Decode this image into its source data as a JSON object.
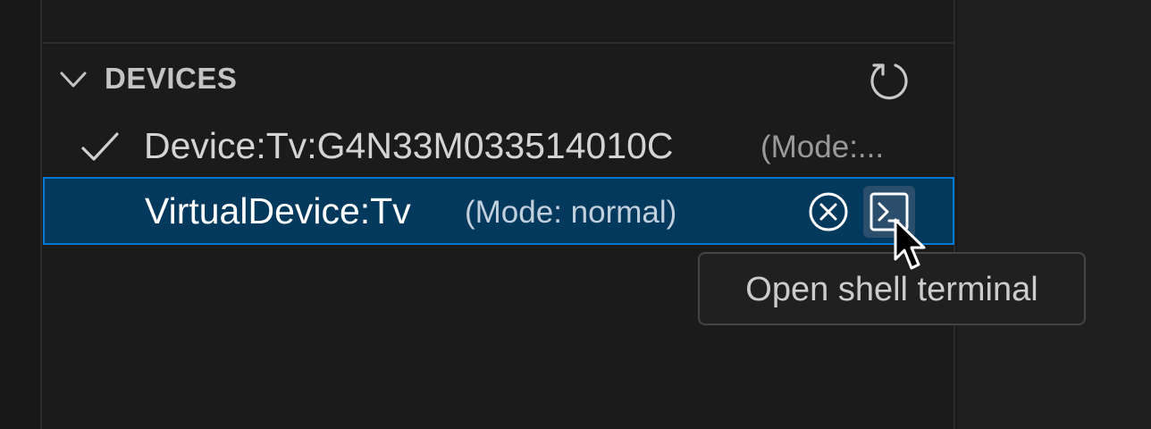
{
  "section": {
    "title": "DEVICES",
    "chevron_icon": "chevron-down-icon",
    "refresh_icon": "refresh-icon"
  },
  "devices": [
    {
      "label": "Device:Tv:G4N33M033514010C",
      "description": "(Mode:...",
      "status_icon": "checkmark-icon",
      "selected": false
    },
    {
      "label": "VirtualDevice:Tv",
      "description": "(Mode: normal)",
      "selected": true
    }
  ],
  "row_actions": [
    {
      "icon": "close-circle-icon"
    },
    {
      "icon": "terminal-icon"
    }
  ],
  "tooltip": {
    "text": "Open shell terminal"
  },
  "colors": {
    "selection_bg": "#04395e",
    "selection_border": "#0078d4",
    "panel_bg": "#1b1b1b"
  }
}
